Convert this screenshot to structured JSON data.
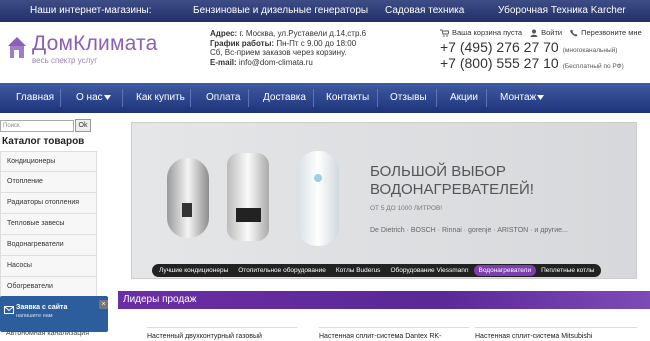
{
  "topbar": {
    "shops_label": "Наши интернет-магазины:",
    "link1": "Бензиновые и дизельные генераторы",
    "link2": "Садовая техника",
    "link3": "Уборочная Техника Karcher"
  },
  "logo": {
    "name": "ДомКлимата",
    "tagline": "весь спектр услуг"
  },
  "address": {
    "addr_label": "Адрес:",
    "addr_value": "г. Москва, ул.Руставели д.14,стр.6",
    "hours_label": "График работы:",
    "hours_value": "Пн-Пт с 9.00 до 18:00",
    "saturday": "Сб, Вс-прием заказов через корзину.",
    "email_label": "E-mail:",
    "email_value": "info@dom-climata.ru"
  },
  "header_links": {
    "cart": "Ваша корзина пуста",
    "login": "Войти",
    "callback": "Перезвоните мне"
  },
  "phones": [
    {
      "number": "+7 (495) 276 27 70",
      "note": "(многоканальный)"
    },
    {
      "number": "+7 (800) 555 27 10",
      "note": "(Бесплатный по РФ)"
    }
  ],
  "nav": [
    "Главная",
    "О нас",
    "Как купить",
    "Оплата",
    "Доставка",
    "Контакты",
    "Отзывы",
    "Акции",
    "Монтаж"
  ],
  "search": {
    "placeholder": "Поиск",
    "button": "Ok"
  },
  "catalog": {
    "title": "Каталог товаров",
    "items": [
      "Кондиционеры",
      "Отопление",
      "Радиаторы отопления",
      "Тепловые завесы",
      "Водонагреватели",
      "Насосы",
      "Обогреватели"
    ]
  },
  "banner": {
    "line1": "БОЛЬШОЙ ВЫБОР",
    "line2": "ВОДОНАГРЕВАТЕЛЕЙ!",
    "sub": "ОТ 5 ДО 1000 ЛИТРОВ!",
    "brands": "De Dietrich  ·  BOSCH  ·  Rinnai  ·  gorenje  ·  ARISTON  ·  и другие..."
  },
  "slider_tabs": [
    {
      "label": "Лучшие кондиционеры",
      "active": false
    },
    {
      "label": "Отопительное оборудование",
      "active": false
    },
    {
      "label": "Котлы Buderus",
      "active": false
    },
    {
      "label": "Оборудование Viessmann",
      "active": false
    },
    {
      "label": "Водонагреватели",
      "active": true
    },
    {
      "label": "Пеплетные котлы",
      "active": false
    }
  ],
  "leaders_title": "Лидеры продаж",
  "products": [
    "Настенный двухконтурный газовый",
    "Настенная сплит-система Dantex RK-",
    "Настенная сплит-система Mitsubishi"
  ],
  "widget": {
    "title": "Заявка с сайта",
    "subtitle": "напишите нам",
    "close": "×",
    "below": "Автономная канализация"
  },
  "colors": {
    "accent": "#7d3fb0",
    "nav": "#2b4490",
    "topbar": "#2c3a75"
  }
}
